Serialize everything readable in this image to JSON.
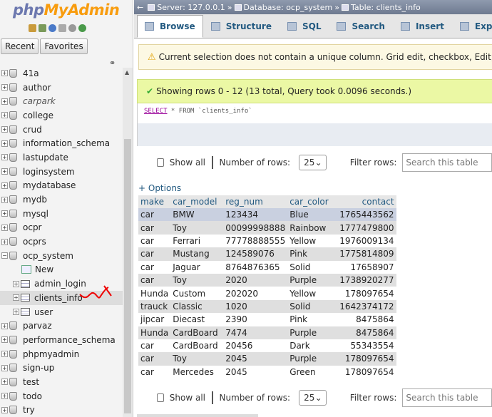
{
  "app": {
    "logo_php": "php",
    "logo_myadmin": "MyAdmin"
  },
  "left": {
    "tabs": [
      "Recent",
      "Favorites"
    ],
    "tree": [
      {
        "label": "41a",
        "type": "db"
      },
      {
        "label": "author",
        "type": "db"
      },
      {
        "label": "carpark",
        "type": "db",
        "italic": true
      },
      {
        "label": "college",
        "type": "db"
      },
      {
        "label": "crud",
        "type": "db"
      },
      {
        "label": "information_schema",
        "type": "db"
      },
      {
        "label": "lastupdate",
        "type": "db"
      },
      {
        "label": "loginsystem",
        "type": "db"
      },
      {
        "label": "mydatabase",
        "type": "db"
      },
      {
        "label": "mydb",
        "type": "db"
      },
      {
        "label": "mysql",
        "type": "db"
      },
      {
        "label": "ocpr",
        "type": "db"
      },
      {
        "label": "ocprs",
        "type": "db"
      },
      {
        "label": "ocp_system",
        "type": "db",
        "expanded": true
      },
      {
        "label": "New",
        "type": "new"
      },
      {
        "label": "admin_login",
        "type": "table"
      },
      {
        "label": "clients_info",
        "type": "table",
        "selected": true
      },
      {
        "label": "user",
        "type": "table"
      },
      {
        "label": "parvaz",
        "type": "db"
      },
      {
        "label": "performance_schema",
        "type": "db"
      },
      {
        "label": "phpmyadmin",
        "type": "db"
      },
      {
        "label": "sign-up",
        "type": "db"
      },
      {
        "label": "test",
        "type": "db"
      },
      {
        "label": "todo",
        "type": "db"
      },
      {
        "label": "try",
        "type": "db"
      }
    ]
  },
  "breadcrumb": {
    "server": "Server: 127.0.0.1",
    "database": "Database: ocp_system",
    "table": "Table: clients_info"
  },
  "tabs": [
    {
      "label": "Browse",
      "active": true,
      "icon": "browse-icon"
    },
    {
      "label": "Structure",
      "icon": "structure-icon"
    },
    {
      "label": "SQL",
      "icon": "sql-icon"
    },
    {
      "label": "Search",
      "icon": "search-icon"
    },
    {
      "label": "Insert",
      "icon": "insert-icon"
    },
    {
      "label": "Export",
      "icon": "export-icon"
    }
  ],
  "warning": "Current selection does not contain a unique column. Grid edit, checkbox, Edit, Copy and Del",
  "success": "Showing rows 0 - 12 (13 total, Query took 0.0096 seconds.)",
  "sql": {
    "select": "SELECT",
    "rest": " * FROM `clients_info`"
  },
  "controls": {
    "show_all": "Show all",
    "number_of_rows": "Number of rows:",
    "rows_value": "25",
    "filter_rows": "Filter rows:",
    "search_placeholder": "Search this table"
  },
  "options_link": "+ Options",
  "table": {
    "columns": [
      "make",
      "car_model",
      "reg_num",
      "car_color",
      "contact"
    ],
    "rows": [
      [
        "car",
        "BMW",
        "123434",
        "Blue",
        "1765443562"
      ],
      [
        "car",
        "Toy",
        "00099998888",
        "Rainbow",
        "1777479800"
      ],
      [
        "car",
        "Ferrari",
        "77778888555",
        "Yellow",
        "1976009134"
      ],
      [
        "car",
        "Mustang",
        "124589076",
        "Pink",
        "1775814809"
      ],
      [
        "car",
        "Jaguar",
        "8764876365",
        "Solid",
        "17658907"
      ],
      [
        "car",
        "Toy",
        "2020",
        "Purple",
        "1738920277"
      ],
      [
        "Hunda",
        "Custom",
        "202020",
        "Yellow",
        "178097654"
      ],
      [
        "trauck",
        "Classic",
        "1020",
        "Solid",
        "1642374172"
      ],
      [
        "jipcar",
        "Diecast",
        "2390",
        "Pink",
        "8475864"
      ],
      [
        "Hunda",
        "CardBoard",
        "7474",
        "Purple",
        "8475864"
      ],
      [
        "car",
        "CardBoard",
        "20456",
        "Dark",
        "55343554"
      ],
      [
        "car",
        "Toy",
        "2045",
        "Purple",
        "178097654"
      ],
      [
        "car",
        "Mercedes",
        "2045",
        "Green",
        "178097654"
      ]
    ]
  }
}
